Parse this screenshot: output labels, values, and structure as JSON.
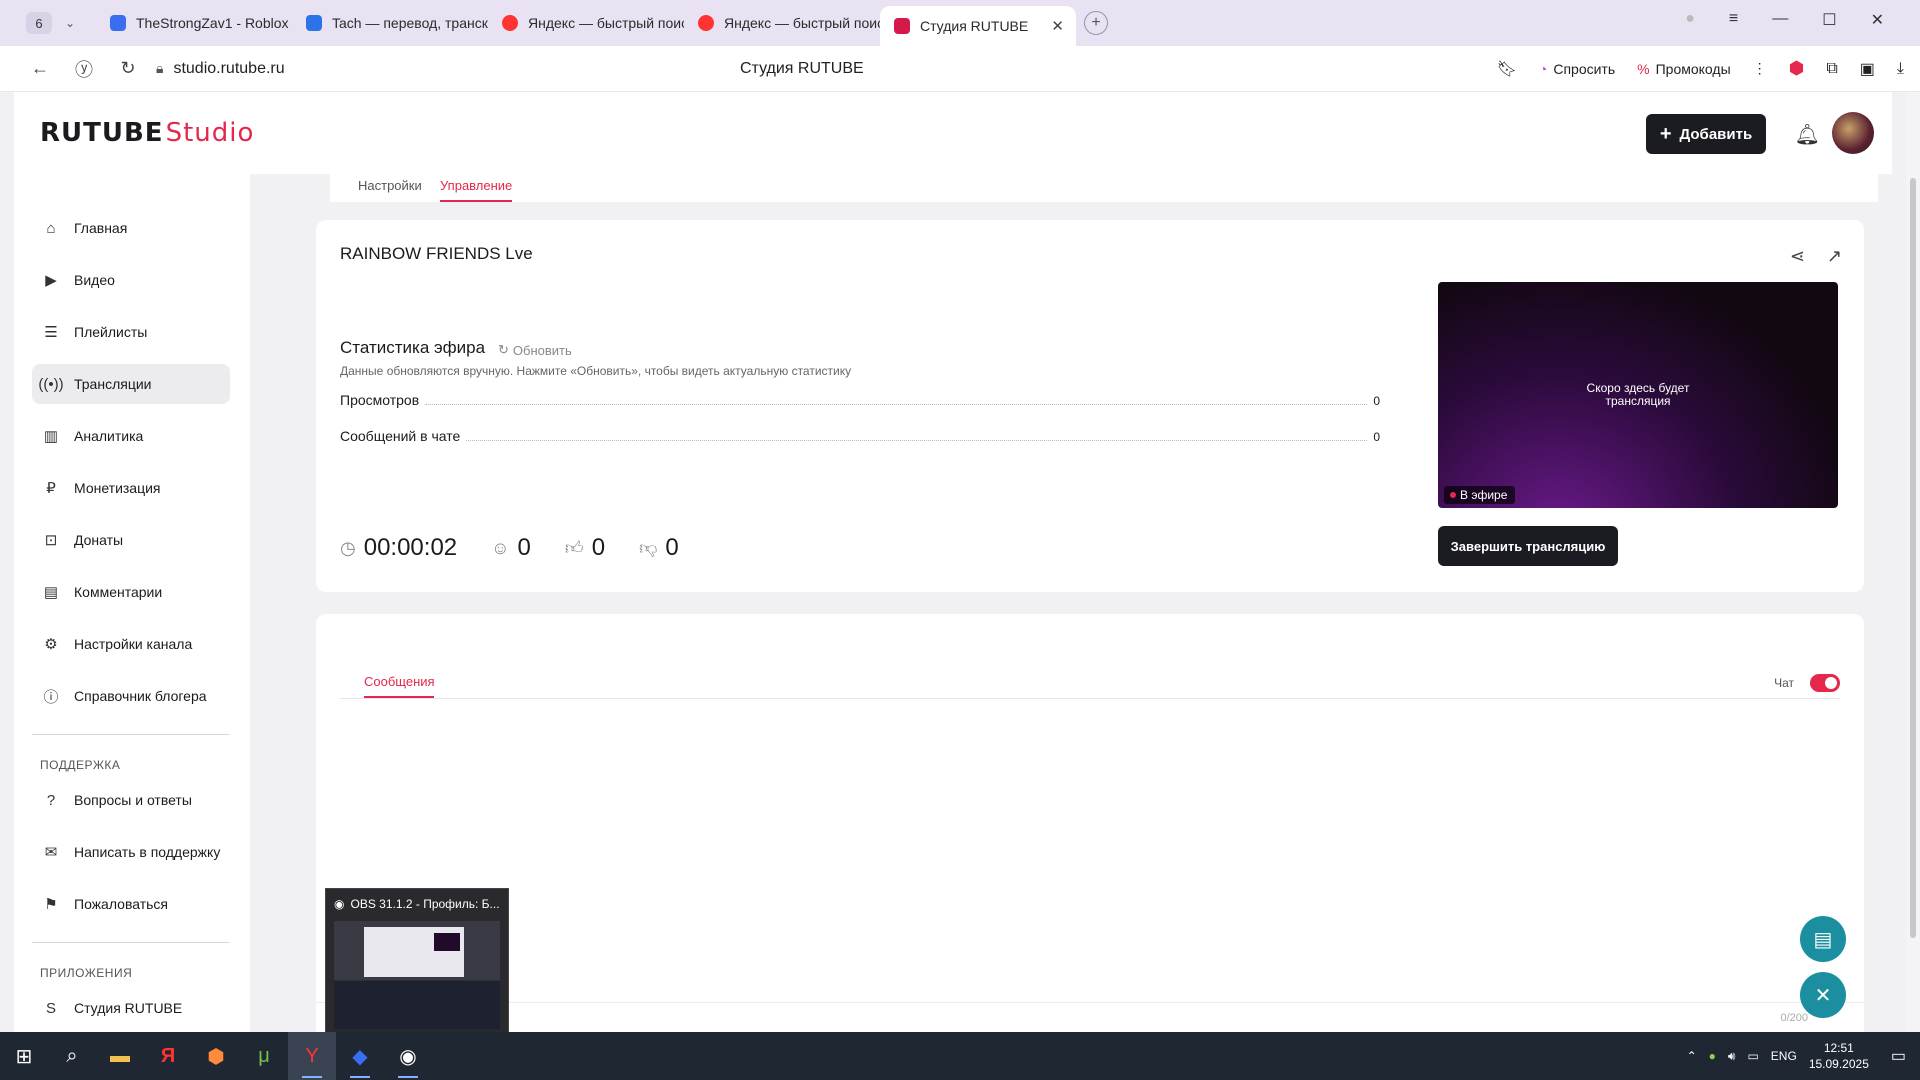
{
  "browser": {
    "tab_count": "6",
    "tabs": [
      {
        "label": "TheStrongZav1 - Roblox",
        "color": "#3b6df0"
      },
      {
        "label": "Tach — перевод, транскр",
        "color": "#2a74e8"
      },
      {
        "label": "Яндекс — быстрый поиск",
        "color": "#f33"
      },
      {
        "label": "Яндекс — быстрый поиск",
        "color": "#f33"
      },
      {
        "label": "Студия RUTUBE",
        "color": "#d6194b"
      }
    ],
    "url": "studio.rutube.ru",
    "page_title": "Студия RUTUBE",
    "ask_label": "Спросить",
    "promo_label": "Промокоды"
  },
  "app": {
    "logo_main": "RUTUBE",
    "logo_accent": "Studio",
    "add_button": "Добавить",
    "accent_color": "#e4274d"
  },
  "sidebar": {
    "items": [
      {
        "label": "Главная",
        "icon": "home-icon"
      },
      {
        "label": "Видео",
        "icon": "video-icon"
      },
      {
        "label": "Плейлисты",
        "icon": "playlist-icon"
      },
      {
        "label": "Трансляции",
        "icon": "broadcast-icon"
      },
      {
        "label": "Аналитика",
        "icon": "analytics-icon"
      },
      {
        "label": "Монетизация",
        "icon": "monetization-icon"
      },
      {
        "label": "Донаты",
        "icon": "donate-icon"
      },
      {
        "label": "Комментарии",
        "icon": "comments-icon"
      },
      {
        "label": "Настройки канала",
        "icon": "gear-icon"
      },
      {
        "label": "Справочник блогера",
        "icon": "info-icon"
      }
    ],
    "support_heading": "ПОДДЕРЖКА",
    "support_items": [
      {
        "label": "Вопросы и ответы",
        "icon": "question-icon"
      },
      {
        "label": "Написать в поддержку",
        "icon": "mail-icon"
      },
      {
        "label": "Пожаловаться",
        "icon": "flag-icon"
      }
    ],
    "apps_heading": "ПРИЛОЖЕНИЯ",
    "apps_items": [
      {
        "label": "Студия RUTUBE",
        "icon": "studio-icon"
      }
    ]
  },
  "tabs": {
    "settings": "Настройки",
    "manage": "Управление"
  },
  "stream": {
    "title": "RAINBOW FRIENDS Lve",
    "stats_title": "Статистика эфира",
    "refresh_label": "Обновить",
    "stats_note": "Данные обновляются вручную. Нажмите «Обновить», чтобы видеть актуальную статистику",
    "stats": [
      {
        "label": "Просмотров",
        "value": "0"
      },
      {
        "label": "Сообщений в чате",
        "value": "0"
      }
    ],
    "duration": "00:00:02",
    "viewers": "0",
    "likes": "0",
    "dislikes": "0",
    "preview_text_line1": "Скоро здесь будет",
    "preview_text_line2": "трансляция",
    "live_badge": "В эфире",
    "end_button": "Завершить трансляцию"
  },
  "chat": {
    "tab_label": "Сообщения",
    "toggle_label": "Чат",
    "toggle_on": true,
    "counter": "0/200"
  },
  "obs_popup": {
    "title": "OBS 31.1.2 - Профиль: Б..."
  },
  "taskbar": {
    "lang": "ENG",
    "time": "12:51",
    "date": "15.09.2025"
  }
}
